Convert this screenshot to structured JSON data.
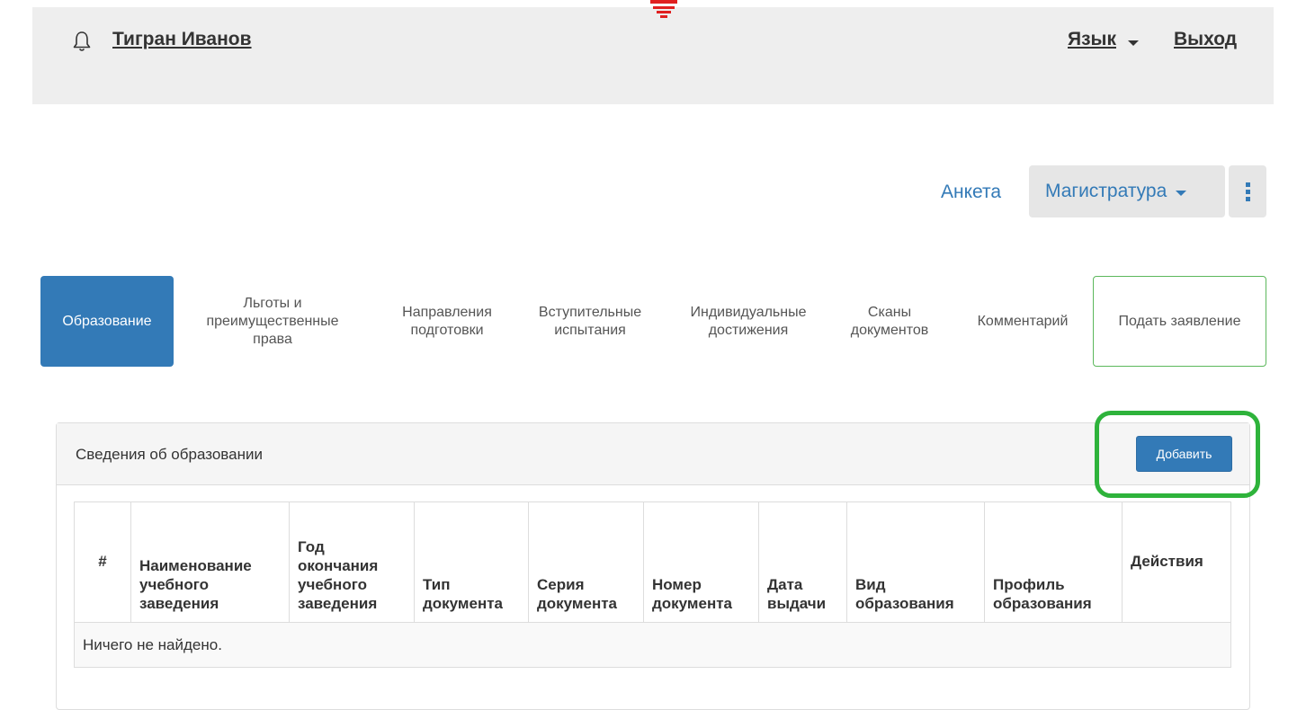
{
  "header": {
    "user_name": "Тигран Иванов",
    "language_label": "Язык",
    "logout_label": "Выход"
  },
  "app_nav": {
    "questionnaire_label": "Анкета",
    "program_label": "Магистратура"
  },
  "tabs": [
    {
      "label": "Образование",
      "active": true
    },
    {
      "label": "Льготы и преимущественные права",
      "active": false
    },
    {
      "label": "Направления подготовки",
      "active": false
    },
    {
      "label": "Вступительные испытания",
      "active": false
    },
    {
      "label": "Индивидуальные достижения",
      "active": false
    },
    {
      "label": "Сканы документов",
      "active": false
    },
    {
      "label": "Комментарий",
      "active": false
    },
    {
      "label": "Подать заявление",
      "active": false
    }
  ],
  "panel": {
    "title": "Сведения об образовании",
    "add_button_label": "Добавить"
  },
  "table": {
    "columns": [
      "#",
      "Наименование учебного заведения",
      "Год окончания учебного заведения",
      "Тип документа",
      "Серия документа",
      "Номер документа",
      "Дата выдачи",
      "Вид образования",
      "Профиль образования",
      "Действия"
    ],
    "empty_message": "Ничего не найдено."
  },
  "colors": {
    "primary": "#337ab7",
    "highlight": "#2eb33b",
    "submit_border": "#5cb85c"
  }
}
